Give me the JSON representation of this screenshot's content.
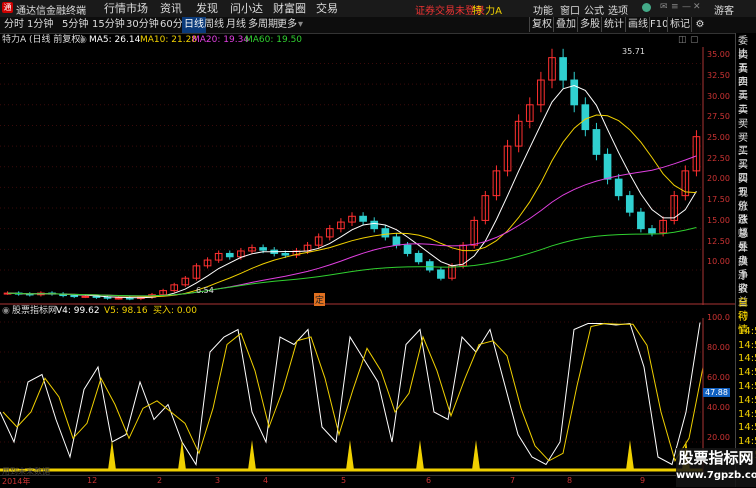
{
  "app": {
    "title": "通达信金融终端",
    "user": "游客",
    "trade_notice": "证券交易未登录",
    "stock_name": "特 力A"
  },
  "menu": [
    "行情",
    "市场",
    "资讯",
    "发现",
    "问小达",
    "财富圈",
    "交易"
  ],
  "top_right_menu": [
    "功能",
    "窗口",
    "公式",
    "选项"
  ],
  "period_tabs": [
    "分时",
    "1分钟",
    "5分钟",
    "15分钟",
    "30分钟",
    "60分钟",
    "日线",
    "周线",
    "月线",
    "多周期",
    "更多"
  ],
  "active_period": "日线",
  "right_buttons": [
    "复权",
    "叠加",
    "多股",
    "统计",
    "画线",
    "F10",
    "标记"
  ],
  "info": {
    "title": "特力A (日线 前复权)",
    "ma5": "MA5: 26.14",
    "ma10": "MA10: 21.28",
    "ma20": "MA20: 19.34",
    "ma60": "MA60: 19.50"
  },
  "colors": {
    "ma5": "#ffffff",
    "ma10": "#f0d000",
    "ma20": "#e040e0",
    "ma60": "#30d030",
    "up": "#ff3030",
    "down": "#30d0d0"
  },
  "price_axis": [
    "35.00",
    "32.50",
    "30.00",
    "27.50",
    "25.00",
    "22.50",
    "20.00",
    "17.50",
    "15.00",
    "12.50",
    "10.00"
  ],
  "price_labels": {
    "high": "35.71",
    "low": "6.54",
    "marker": "定"
  },
  "osc": {
    "title": "股票指标网",
    "v4": "V4: 99.62",
    "v5": "V5: 98.16",
    "buy": "买入: 0.00",
    "badge": "47.88"
  },
  "osc_axis": [
    "100.0",
    "80.00",
    "60.00",
    "40.00",
    "20.00"
  ],
  "right_panel": [
    "委比",
    "卖五",
    "卖四",
    "卖三",
    "卖二",
    "卖一",
    "买一",
    "买二",
    "买三",
    "买四",
    "买五",
    "现价",
    "涨跌",
    "涨幅",
    "总量",
    "外盘",
    "换手",
    "净资",
    "收益",
    "自动",
    "行情",
    "14:56",
    "14:56",
    "14:56",
    "14:56",
    "14:56",
    "14:56",
    "14:56",
    "14:56",
    "14:56",
    "14:56"
  ],
  "x_axis": [
    "2014年",
    "12",
    "2",
    "3",
    "4",
    "5",
    "6",
    "7",
    "8",
    "9"
  ],
  "watermark": {
    "line1": "股票指标网",
    "line2": "www.7gpzb.com"
  },
  "bottom_text": "用到未来数据",
  "chart_data": {
    "type": "candlestick",
    "prices_close": [
      7.2,
      7.1,
      7.0,
      7.2,
      7.1,
      6.9,
      6.8,
      6.8,
      6.7,
      6.6,
      6.6,
      6.54,
      6.7,
      7.0,
      7.5,
      8.2,
      9.0,
      10.5,
      11.2,
      12.0,
      11.6,
      12.3,
      12.7,
      12.4,
      12.0,
      11.8,
      12.3,
      13.0,
      14.0,
      15.0,
      15.8,
      16.5,
      15.9,
      15.0,
      14.0,
      13.0,
      12.0,
      11.0,
      10.0,
      9.0,
      10.5,
      13.0,
      16.0,
      19.0,
      22.0,
      25.0,
      28.0,
      30.0,
      33.0,
      35.71,
      33.0,
      30.0,
      27.0,
      24.0,
      21.0,
      19.0,
      17.0,
      15.0,
      14.5,
      16.0,
      19.0,
      22.0,
      26.14
    ],
    "osc_v4": [
      40,
      20,
      60,
      65,
      35,
      10,
      55,
      70,
      20,
      25,
      60,
      35,
      45,
      20,
      5,
      80,
      90,
      95,
      40,
      20,
      90,
      85,
      95,
      30,
      20,
      90,
      75,
      60,
      20,
      85,
      95,
      40,
      35,
      90,
      80,
      95,
      60,
      25,
      10,
      5,
      20,
      95,
      99,
      99,
      98,
      99,
      70,
      10,
      5,
      40,
      99.62
    ],
    "osc_buy_days": [
      8,
      13,
      18,
      25,
      30,
      34,
      45,
      49
    ],
    "price_ylim": [
      6.0,
      37.0
    ],
    "osc_ylim": [
      0,
      100
    ]
  }
}
